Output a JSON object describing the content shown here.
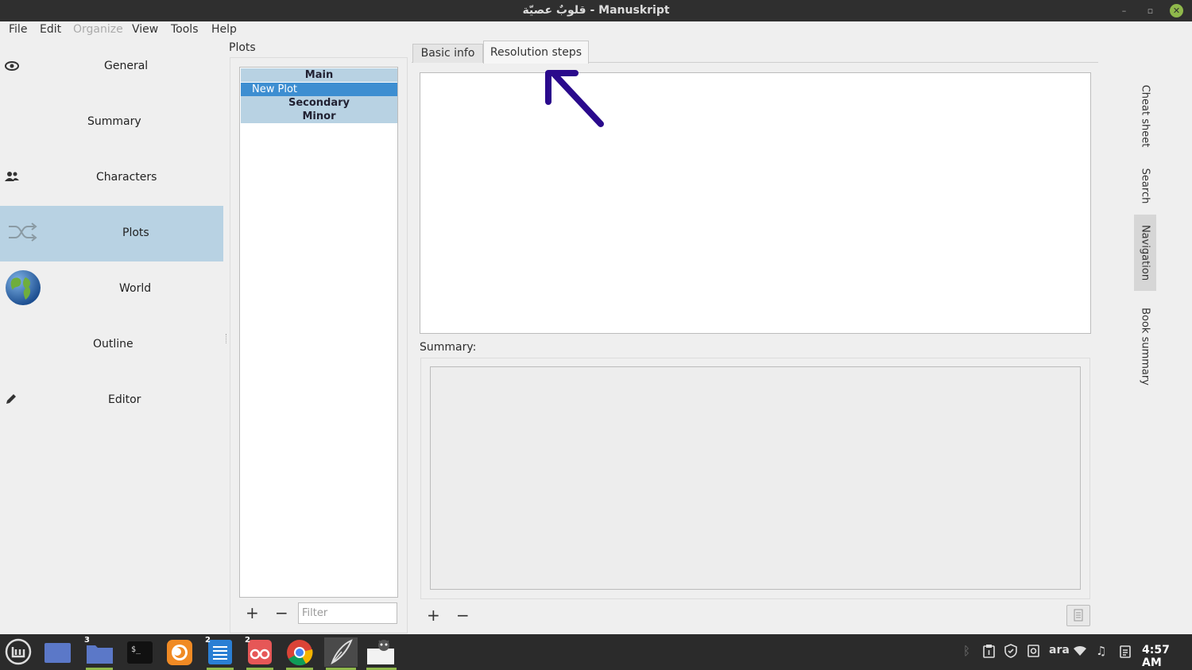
{
  "window": {
    "title": "قلوبٌ عصيّة - Manuskript",
    "min_glyph": "–",
    "max_glyph": "▫",
    "close_glyph": "✕"
  },
  "menu": {
    "items": [
      "File",
      "Edit",
      "Organize",
      "View",
      "Tools",
      "Help"
    ]
  },
  "navigation": {
    "items": [
      {
        "label": "General",
        "icon": "eye-icon"
      },
      {
        "label": "Summary",
        "icon": ""
      },
      {
        "label": "Characters",
        "icon": "people-icon"
      },
      {
        "label": "Plots",
        "icon": "shuffle-icon"
      },
      {
        "label": "World",
        "icon": "globe-icon"
      },
      {
        "label": "Outline",
        "icon": ""
      },
      {
        "label": "Editor",
        "icon": "pencil-icon"
      }
    ],
    "active": "Plots"
  },
  "plots_panel": {
    "title": "Plots",
    "rows": [
      "Main",
      "New Plot",
      "Secondary",
      "Minor"
    ],
    "selected": "New Plot",
    "add_glyph": "+",
    "remove_glyph": "−",
    "filter_placeholder": "Filter"
  },
  "editor": {
    "tabs": [
      "Basic info",
      "Resolution steps"
    ],
    "active_tab": "Resolution steps",
    "summary_label": "Summary:",
    "add_glyph": "+",
    "remove_glyph": "−"
  },
  "annotation": {
    "arrow_color": "#2a0a8c"
  },
  "right_tabs": {
    "items": [
      "Cheat sheet",
      "Search",
      "Navigation",
      "Book summary"
    ],
    "active": "Navigation"
  },
  "taskbar": {
    "apps": [
      {
        "name": "menu-icon",
        "badge": ""
      },
      {
        "name": "show-desktop-icon",
        "badge": ""
      },
      {
        "name": "files-icon",
        "badge": "3"
      },
      {
        "name": "terminal-icon",
        "badge": ""
      },
      {
        "name": "firefox-icon",
        "badge": ""
      },
      {
        "name": "text-editor-icon",
        "badge": "2"
      },
      {
        "name": "reader-icon",
        "badge": "2"
      },
      {
        "name": "chrome-icon",
        "badge": ""
      },
      {
        "name": "manuskript-icon",
        "badge": ""
      },
      {
        "name": "screenshot-icon",
        "badge": ""
      }
    ],
    "keyboard_layout": "ara",
    "clock": "4:57 AM"
  }
}
